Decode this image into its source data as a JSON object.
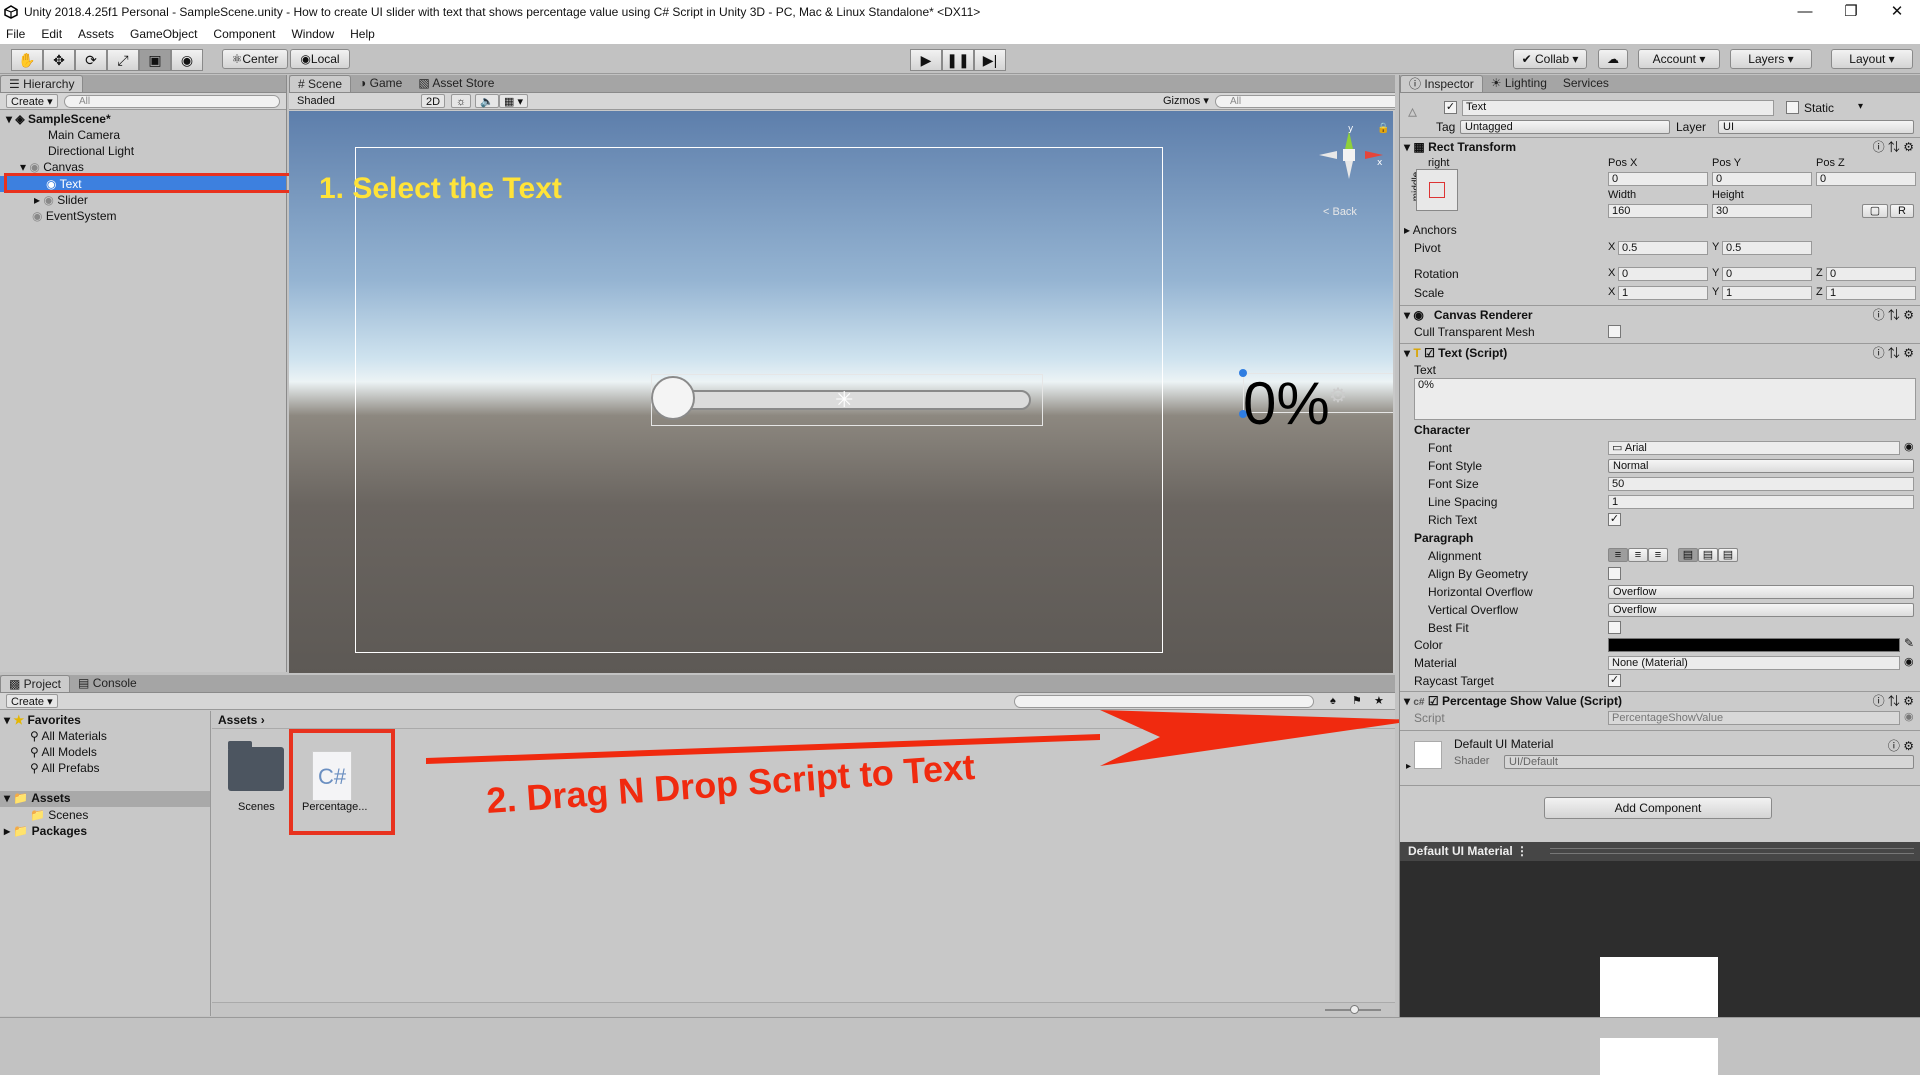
{
  "window": {
    "title": "Unity 2018.4.25f1 Personal - SampleScene.unity - How to create UI slider with text that shows percentage value  using C# Script in Unity 3D - PC, Mac & Linux Standalone* <DX11>"
  },
  "menu": [
    "File",
    "Edit",
    "Assets",
    "GameObject",
    "Component",
    "Window",
    "Help"
  ],
  "toolbar": {
    "pivot": "Center",
    "space": "Local",
    "collab": "Collab",
    "account": "Account",
    "layers": "Layers",
    "layout": "Layout"
  },
  "hierarchy": {
    "tab": "Hierarchy",
    "create": "Create",
    "search_placeholder": "All",
    "scene": "SampleScene*",
    "items": [
      "Main Camera",
      "Directional Light",
      "Canvas",
      "Text",
      "Slider",
      "EventSystem"
    ]
  },
  "scene": {
    "tabs": [
      "Scene",
      "Game",
      "Asset Store"
    ],
    "shading": "Shaded",
    "mode2d": "2D",
    "gizmos": "Gizmos",
    "search_placeholder": "All",
    "back": "< Back",
    "percent_text": "0%"
  },
  "annotations": {
    "step1": "1. Select the Text",
    "step2": "2. Drag N Drop Script to Text"
  },
  "project": {
    "tabs": [
      "Project",
      "Console"
    ],
    "create": "Create",
    "favorites": "Favorites",
    "fav_items": [
      "All Materials",
      "All Models",
      "All Prefabs"
    ],
    "assets": "Assets",
    "asset_children": [
      "Scenes"
    ],
    "packages": "Packages",
    "breadcrumb": "Assets",
    "files": [
      "Scenes",
      "Percentage..."
    ],
    "script_glyph": "C#"
  },
  "inspector": {
    "tabs": [
      "Inspector",
      "Lighting",
      "Services"
    ],
    "object_name": "Text",
    "static": "Static",
    "tag_label": "Tag",
    "tag": "Untagged",
    "layer_label": "Layer",
    "layer": "UI",
    "rect": {
      "title": "Rect Transform",
      "anchor_h": "right",
      "anchor_v": "middle",
      "posx_l": "Pos X",
      "posy_l": "Pos Y",
      "posz_l": "Pos Z",
      "posx": "0",
      "posy": "0",
      "posz": "0",
      "width_l": "Width",
      "height_l": "Height",
      "width": "160",
      "height": "30",
      "r_btn": "R",
      "anchors": "Anchors",
      "pivot": "Pivot",
      "pivot_x": "0.5",
      "pivot_y": "0.5",
      "rotation": "Rotation",
      "rot_x": "0",
      "rot_y": "0",
      "rot_z": "0",
      "scale": "Scale",
      "scale_x": "1",
      "scale_y": "1",
      "scale_z": "1",
      "x": "X",
      "y": "Y",
      "z": "Z"
    },
    "canvas_renderer": {
      "title": "Canvas Renderer",
      "cull": "Cull Transparent Mesh"
    },
    "text_script": {
      "title": "Text (Script)",
      "text_l": "Text",
      "text": "0%",
      "character": "Character",
      "font_l": "Font",
      "font": "Arial",
      "style_l": "Font Style",
      "style": "Normal",
      "size_l": "Font Size",
      "size": "50",
      "spacing_l": "Line Spacing",
      "spacing": "1",
      "rich_l": "Rich Text",
      "paragraph": "Paragraph",
      "align_l": "Alignment",
      "geom_l": "Align By Geometry",
      "hover_l": "Horizontal Overflow",
      "hover": "Overflow",
      "vover_l": "Vertical Overflow",
      "vover": "Overflow",
      "bestfit_l": "Best Fit",
      "color_l": "Color",
      "color": "#000000",
      "material_l": "Material",
      "material": "None (Material)",
      "raycast_l": "Raycast Target"
    },
    "percentage": {
      "title": "Percentage Show Value (Script)",
      "script_l": "Script",
      "script": "PercentageShowValue"
    },
    "material": {
      "title": "Default UI Material",
      "shader_l": "Shader",
      "shader": "UI/Default"
    },
    "add_component": "Add Component",
    "preview_title": "Default UI Material"
  },
  "colors": {
    "annotation_red": "#f02a0f",
    "annotation_yellow": "#ffe338",
    "selection": "#3d80df"
  }
}
